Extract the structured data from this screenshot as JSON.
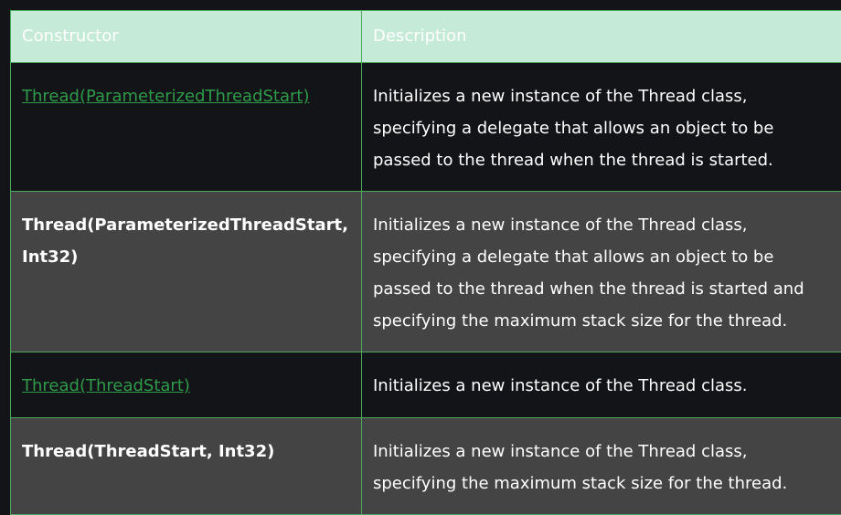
{
  "table": {
    "headers": [
      "Constructor",
      "Description"
    ],
    "rows": [
      {
        "constructor": "Thread(ParameterizedThreadStart)",
        "is_link": true,
        "description": "Initializes a new instance of the Thread class, specifying a delegate that allows an object to be passed to the thread when the thread is started."
      },
      {
        "constructor": "Thread(ParameterizedThreadStart, Int32)",
        "is_link": false,
        "description": "Initializes a new instance of the Thread class, specifying a delegate that allows an object to be passed to the thread when the thread is started and specifying the maximum stack size for the thread."
      },
      {
        "constructor": "Thread(ThreadStart)",
        "is_link": true,
        "description": "Initializes a new instance of the Thread class."
      },
      {
        "constructor": "Thread(ThreadStart, Int32)",
        "is_link": false,
        "description": "Initializes a new instance of the Thread class, specifying the maximum stack size for the thread."
      }
    ]
  },
  "colors": {
    "header_bg": "#c5ead7",
    "border": "#4fa85f",
    "link": "#2f9a4a",
    "row_dark": "#131417",
    "row_grey": "#444444"
  }
}
